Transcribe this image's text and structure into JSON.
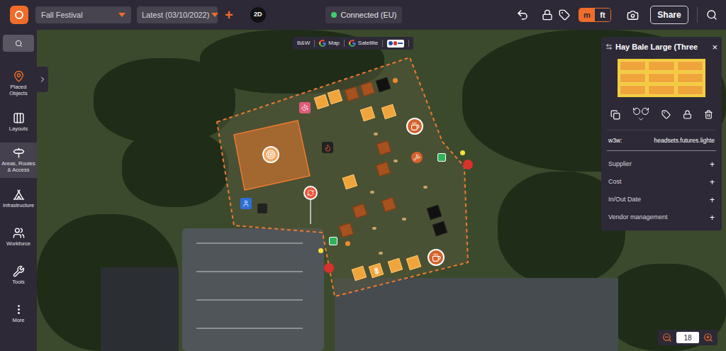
{
  "topbar": {
    "project": "Fall Festival",
    "version": "Latest (03/10/2022)",
    "add": "+",
    "view_mode": "2D",
    "connection": {
      "label": "Connected (EU)",
      "connected": true
    },
    "units": [
      {
        "label": "m",
        "selected": true
      },
      {
        "label": "ft",
        "selected": false
      }
    ],
    "share": "Share"
  },
  "sidebar": {
    "items": [
      {
        "label": "Placed Objects",
        "selected": false,
        "accent": true
      },
      {
        "label": "Layouts",
        "selected": false,
        "accent": false
      },
      {
        "label": "Areas, Routes & Access",
        "selected": true,
        "accent": false
      },
      {
        "label": "Infrastructure",
        "selected": false,
        "accent": false
      },
      {
        "label": "Workforce",
        "selected": false,
        "accent": false
      },
      {
        "label": "Tools",
        "selected": false,
        "accent": false
      },
      {
        "label": "More",
        "selected": false,
        "accent": false
      }
    ]
  },
  "map": {
    "layers": [
      {
        "label": "B&W",
        "kind": "plain"
      },
      {
        "label": "Map",
        "kind": "google"
      },
      {
        "label": "Satellite",
        "kind": "google"
      }
    ]
  },
  "panel": {
    "title": "Hay Bale Large (Three",
    "close": "×",
    "w3w": {
      "label": "w3w:",
      "value": "headsets.futures.lighte"
    },
    "sections": [
      {
        "label": "Supplier",
        "action": "+"
      },
      {
        "label": "Cost",
        "action": "+"
      },
      {
        "label": "In/Out Date",
        "action": "+"
      },
      {
        "label": "Vendor management",
        "action": "+"
      }
    ]
  },
  "zoom": {
    "level": "18"
  }
}
